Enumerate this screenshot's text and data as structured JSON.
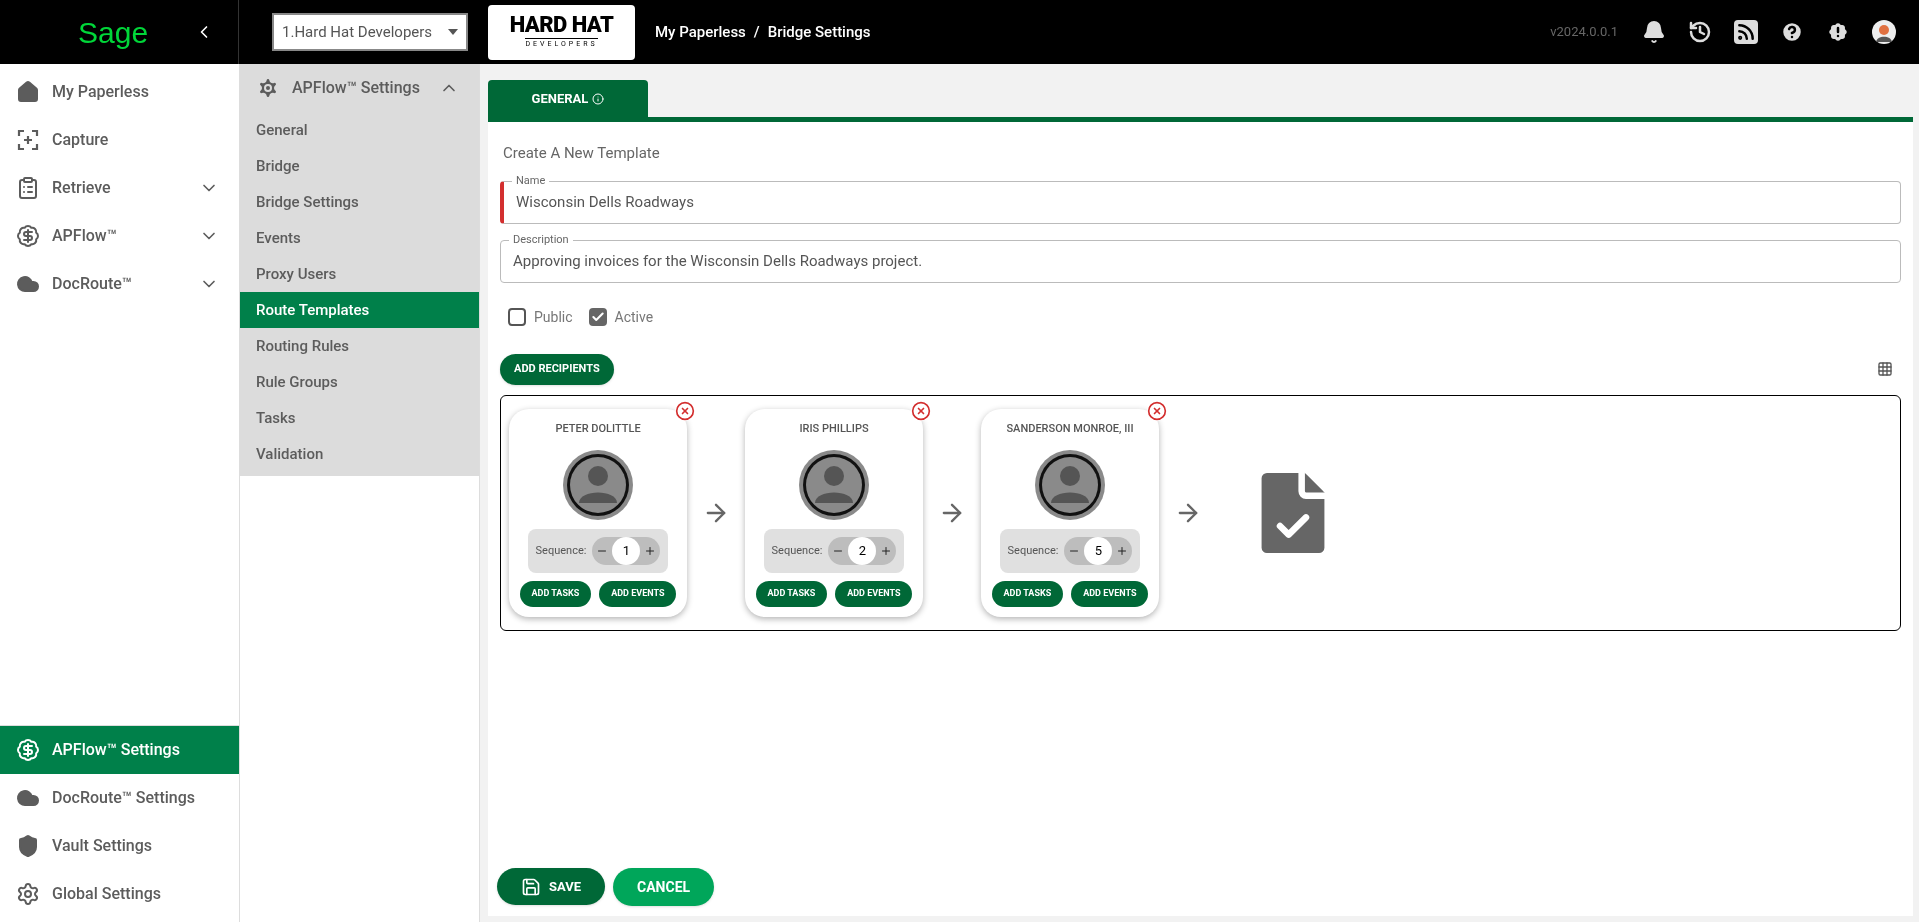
{
  "header": {
    "logo": "Sage",
    "company_select": {
      "value": "1.Hard Hat Developers"
    },
    "brand_logo": {
      "top": "HARD HAT",
      "bottom": "DEVELOPERS"
    },
    "breadcrumb": [
      {
        "label": "My Paperless"
      },
      {
        "label": "Bridge Settings"
      }
    ],
    "breadcrumb_separator": "/",
    "version": "v2024.0.0.1"
  },
  "sidebar": {
    "items": [
      {
        "kind": "home",
        "label": "My Paperless",
        "expandable": false,
        "selected": false
      },
      {
        "kind": "capture",
        "label": "Capture",
        "expandable": false,
        "selected": false
      },
      {
        "kind": "retrieve",
        "label": "Retrieve",
        "expandable": true,
        "selected": false
      },
      {
        "kind": "apflow",
        "label": "APFlow™",
        "expandable": true,
        "selected": false
      },
      {
        "kind": "docroute",
        "label": "DocRoute™",
        "expandable": true,
        "selected": false
      }
    ],
    "settings_items": [
      {
        "kind": "apflow",
        "label": "APFlow™ Settings",
        "selected": true
      },
      {
        "kind": "docroute",
        "label": "DocRoute™ Settings",
        "selected": false
      },
      {
        "kind": "vault",
        "label": "Vault Settings",
        "selected": false
      },
      {
        "kind": "global",
        "label": "Global Settings",
        "selected": false
      }
    ]
  },
  "submenu": {
    "title": "APFlow™ Settings",
    "expanded": true,
    "items": [
      {
        "label": "General",
        "selected": false
      },
      {
        "label": "Bridge",
        "selected": false
      },
      {
        "label": "Bridge Settings",
        "selected": false
      },
      {
        "label": "Events",
        "selected": false
      },
      {
        "label": "Proxy Users",
        "selected": false
      },
      {
        "label": "Route Templates",
        "selected": true
      },
      {
        "label": "Routing Rules",
        "selected": false
      },
      {
        "label": "Rule Groups",
        "selected": false
      },
      {
        "label": "Tasks",
        "selected": false
      },
      {
        "label": "Validation",
        "selected": false
      }
    ]
  },
  "tabs": [
    {
      "label": "GENERAL",
      "selected": true
    }
  ],
  "form": {
    "heading": "Create A New Template",
    "fields": [
      {
        "label": "Name",
        "value": "Wisconsin Dells Roadways",
        "required": true
      },
      {
        "label": "Description",
        "value": "Approving invoices for the Wisconsin Dells Roadways project.",
        "required": false
      }
    ],
    "checkboxes": [
      {
        "label": "Public",
        "checked": false
      },
      {
        "label": "Active",
        "checked": true
      }
    ]
  },
  "add_recipients": "ADD RECIPIENTS",
  "recipients": [
    {
      "name": "PETER DOLITTLE",
      "sequence_label": "Sequence:",
      "sequence": "1",
      "tasks_button": "ADD TASKS",
      "events_button": "ADD EVENTS"
    },
    {
      "name": "IRIS PHILLIPS",
      "sequence_label": "Sequence:",
      "sequence": "2",
      "tasks_button": "ADD TASKS",
      "events_button": "ADD EVENTS"
    },
    {
      "name": "SANDERSON MONROE, III",
      "sequence_label": "Sequence:",
      "sequence": "5",
      "tasks_button": "ADD TASKS",
      "events_button": "ADD EVENTS"
    }
  ],
  "actions": {
    "save": "SAVE",
    "cancel": "CANCEL"
  }
}
